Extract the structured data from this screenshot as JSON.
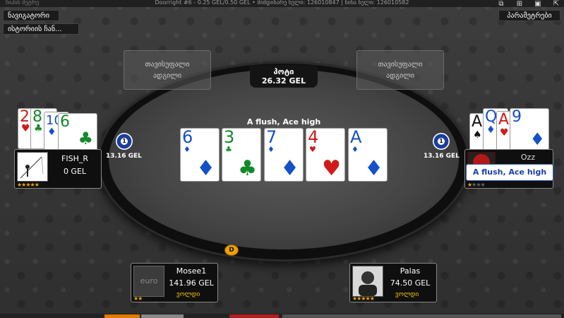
{
  "titlebar": {
    "faded_left": "ჩიპის მეტრე",
    "title": "Doorright #6 - 0.25 GEL/0.50 GEL • მიმდინარე ხელი: 126010847 | წინა ხელი: 126010582"
  },
  "menu": {
    "navigator": "ნავიგატორი",
    "history": "ისტორიის ჩან...",
    "settings": "პარამეტრები"
  },
  "pot": {
    "label": "პოტი",
    "amount": "26.32 GEL"
  },
  "empty_seats": [
    {
      "line1": "თავისუფალი",
      "line2": "ადგილი"
    },
    {
      "line1": "თავისუფალი",
      "line2": "ადგილი"
    }
  ],
  "hand_result": "A flush, Ace high",
  "board": [
    {
      "rank": "6",
      "suit": "♦",
      "color": "blue"
    },
    {
      "rank": "3",
      "suit": "♣",
      "color": "green"
    },
    {
      "rank": "7",
      "suit": "♦",
      "color": "blue"
    },
    {
      "rank": "4",
      "suit": "♥",
      "color": "red"
    },
    {
      "rank": "A",
      "suit": "♦",
      "color": "blue"
    }
  ],
  "players": {
    "fish": {
      "name": "FISH_R",
      "stack": "0 GEL",
      "stars": "★★★★★",
      "bet": "13.16 GEL",
      "chip_label": "1",
      "cards": [
        {
          "rank": "2",
          "suit": "♥",
          "color": "red"
        },
        {
          "rank": "8",
          "suit": "♣",
          "color": "green"
        },
        {
          "rank": "10",
          "suit": "♦",
          "color": "blue"
        },
        {
          "rank": "6",
          "suit": "♣",
          "color": "green"
        }
      ]
    },
    "ozz": {
      "name": "Ozz",
      "stack": "",
      "stars": "★",
      "stars_off": "★★★",
      "bet": "13.16 GEL",
      "chip_label": "1",
      "cards": [
        {
          "rank": "A",
          "suit": "♠",
          "color": "black"
        },
        {
          "rank": "Q",
          "suit": "♦",
          "color": "blue"
        },
        {
          "rank": "A",
          "suit": "♥",
          "color": "red"
        },
        {
          "rank": "9",
          "suit": "♦",
          "color": "blue"
        }
      ]
    },
    "mosee": {
      "name": "Mosee1",
      "stack": "141.96 GEL",
      "status": "ვოლდი",
      "stars": "★★",
      "avatar_text": "euro"
    },
    "palas": {
      "name": "Palas",
      "stack": "74.50 GEL",
      "status": "ვოლდი",
      "stars": "★★★★★"
    }
  },
  "dealer_button": "D",
  "icons": [
    "restore-icon",
    "table-layout-icon",
    "camera-icon",
    "close-window-icon"
  ]
}
